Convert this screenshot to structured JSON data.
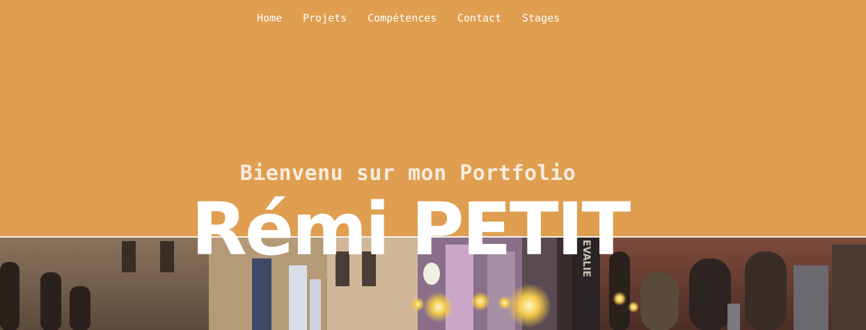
{
  "nav": {
    "items": [
      {
        "label": "Home"
      },
      {
        "label": "Projets"
      },
      {
        "label": "Compétences"
      },
      {
        "label": "Contact"
      },
      {
        "label": "Stages"
      }
    ]
  },
  "hero": {
    "welcome": "Bienvenu sur mon Portfolio",
    "name": "Rémi PETIT",
    "sign_text": "EVALIE"
  },
  "colors": {
    "background": "#df9e50",
    "text": "#ffffff"
  }
}
